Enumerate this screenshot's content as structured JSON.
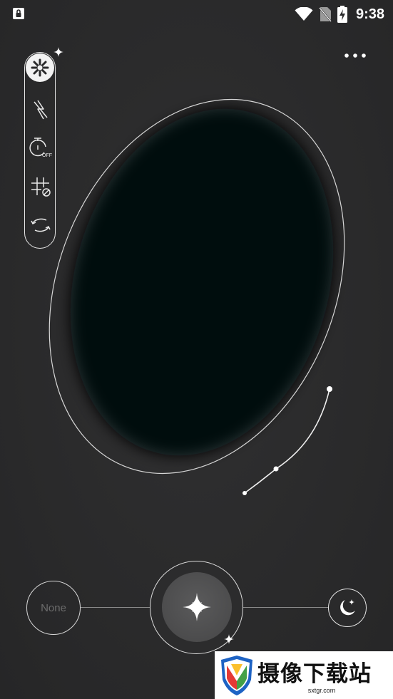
{
  "status_bar": {
    "time": "9:38",
    "icons": [
      "lock-icon",
      "wifi-icon",
      "no-sim-icon",
      "battery-charging-icon"
    ]
  },
  "toolbar": {
    "items": [
      {
        "name": "flower-mode-icon",
        "active": true
      },
      {
        "name": "flash-off-icon",
        "active": false
      },
      {
        "name": "timer-off-icon",
        "label": "OFF",
        "active": false
      },
      {
        "name": "grid-off-icon",
        "active": false
      },
      {
        "name": "switch-camera-icon",
        "active": false
      }
    ],
    "more_icon": "more-dots-icon"
  },
  "bottom": {
    "none_label": "None",
    "shutter_icon": "sparkle-star-icon",
    "night_icon": "moon-star-icon"
  },
  "watermark": {
    "title": "摄像下载站",
    "url": "sxtgr.com"
  },
  "colors": {
    "background": "#2b2b2c",
    "viewfinder": "#05080d",
    "outline": "#e6e6e6"
  }
}
